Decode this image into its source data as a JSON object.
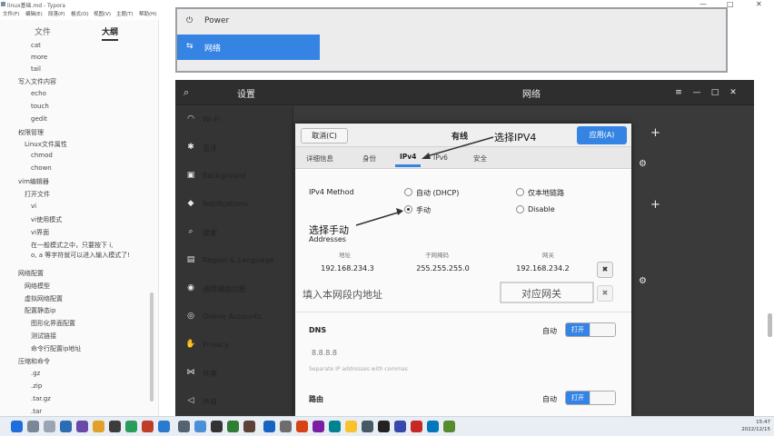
{
  "app": {
    "title": "linux基础.md - Typora",
    "window_controls": [
      "—",
      "□",
      "✕"
    ]
  },
  "menu": [
    "文件(F)",
    "编辑(E)",
    "段落(P)",
    "格式(O)",
    "视图(V)",
    "主题(T)",
    "帮助(H)"
  ],
  "sidebar": {
    "tabs": [
      "文件",
      "大纲"
    ],
    "outline": [
      "cat",
      "more",
      "tail",
      "写入文件内容",
      "echo",
      "touch",
      "gedit",
      "权限管理",
      "Linux文件属性",
      "chmod",
      "chown",
      "vim编辑器",
      "打开文件",
      "vi",
      "vi使用模式",
      "vi界面",
      "在一般模式之中，只要按下 i,",
      "o, a 等字符就可以进入输入模式了!",
      "网络配置",
      "网络模型",
      "虚拟网络配置",
      "配置静态ip",
      "图形化界面配置",
      "测试链接",
      "命令行配置ip地址",
      "压缩和命令",
      ".gz",
      ".zip",
      ".tar.gz",
      ".tar"
    ]
  },
  "top_shot": {
    "items": [
      {
        "icon": "⏻",
        "label": "Power"
      },
      {
        "icon": "⇆",
        "label": "网络"
      }
    ]
  },
  "settings": {
    "title": "设置",
    "network_title": "网络",
    "header_buttons": [
      "≡",
      "—",
      "□",
      "✕"
    ],
    "items": [
      {
        "icon": "wifi-icon",
        "glyph": "◠",
        "label": "Wi-Fi"
      },
      {
        "icon": "bluetooth-icon",
        "glyph": "✱",
        "label": "蓝牙"
      },
      {
        "icon": "background-icon",
        "glyph": "▣",
        "label": "Background"
      },
      {
        "icon": "notifications-icon",
        "glyph": "◆",
        "label": "Notifications"
      },
      {
        "icon": "search-icon",
        "glyph": "⌕",
        "label": "搜索"
      },
      {
        "icon": "region-icon",
        "glyph": "▤",
        "label": "Region & Language"
      },
      {
        "icon": "accessibility-icon",
        "glyph": "◉",
        "label": "通用辅助功能"
      },
      {
        "icon": "online-accounts-icon",
        "glyph": "◎",
        "label": "Online Accounts"
      },
      {
        "icon": "privacy-icon",
        "glyph": "✋",
        "label": "Privacy"
      },
      {
        "icon": "sharing-icon",
        "glyph": "⋈",
        "label": "共享"
      },
      {
        "icon": "sound-icon",
        "glyph": "◁",
        "label": "声音"
      }
    ]
  },
  "dialog": {
    "cancel": "取消(C)",
    "title": "有线",
    "apply": "应用(A)",
    "tabs": [
      "详细信息",
      "身份",
      "IPv4",
      "IPv6",
      "安全"
    ],
    "active_tab": "IPv4",
    "ipv4_method_label": "IPv4 Method",
    "methods": [
      {
        "label": "自动 (DHCP)",
        "selected": false
      },
      {
        "label": "仅本地链路",
        "selected": false
      },
      {
        "label": "手动",
        "selected": true
      },
      {
        "label": "Disable",
        "selected": false
      }
    ],
    "addresses_label": "Addresses",
    "columns": [
      "地址",
      "子网掩码",
      "网关"
    ],
    "row": {
      "address": "192.168.234.3",
      "netmask": "255.255.255.0",
      "gateway": "192.168.234.2"
    },
    "dns_label": "DNS",
    "dns_auto": "自动",
    "dns_toggle": "打开",
    "dns_value": "8.8.8.8",
    "dns_hint": "Separate IP addresses with commas",
    "route_label": "路由",
    "route_auto": "自动",
    "route_toggle": "打开"
  },
  "annotations": {
    "select_ipv4": "选择IPV4",
    "select_manual": "选择手动",
    "fill_ip": "填入本网段内地址",
    "gateway_note": "对应网关"
  },
  "taskbar": {
    "time": "15:47",
    "date": "2022/12/15"
  },
  "colors": {
    "accent": "#3584e4",
    "settings_bg": "#3a3a3a"
  }
}
